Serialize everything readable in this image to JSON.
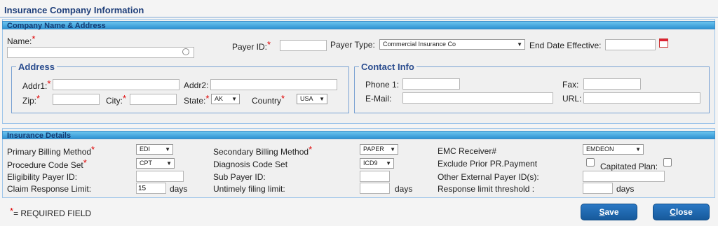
{
  "page": {
    "title": "Insurance Company Information"
  },
  "company": {
    "section_title": "Company Name & Address",
    "name_label": "Name:",
    "payer_id_label": "Payer ID:",
    "payer_type_label": "Payer Type:",
    "payer_type_value": "Commercial Insurance Co",
    "end_date_label": "End Date Effective:"
  },
  "address": {
    "legend": "Address",
    "addr1_label": "Addr1:",
    "addr2_label": "Addr2:",
    "zip_label": "Zip:",
    "city_label": "City:",
    "state_label": "State:",
    "state_value": "AK",
    "country_label": "Country",
    "country_value": "USA"
  },
  "contact": {
    "legend": "Contact Info",
    "phone_label": "Phone 1:",
    "fax_label": "Fax:",
    "email_label": "E-Mail:",
    "url_label": "URL:"
  },
  "details": {
    "section_title": "Insurance Details",
    "primary_billing_label": "Primary Billing Method",
    "primary_billing_value": "EDI",
    "secondary_billing_label": "Secondary Billing Method",
    "secondary_billing_value": "PAPER",
    "emc_label": "EMC Receiver#",
    "emc_value": "EMDEON",
    "procedure_label": "Procedure Code Set",
    "procedure_value": "CPT",
    "diagnosis_label": "Diagnosis Code Set",
    "diagnosis_value": "ICD9",
    "exclude_label": "Exclude Prior PR.Payment",
    "capitated_label": "Capitated Plan:",
    "eligibility_label": "Eligibility Payer ID:",
    "sub_payer_label": "Sub Payer ID:",
    "other_external_label": "Other External Payer ID(s):",
    "claim_response_label": "Claim Response Limit:",
    "claim_response_value": "15",
    "days1": "days",
    "untimely_label": "Untimely filing limit:",
    "days2": "days",
    "response_threshold_label": "Response limit threshold :",
    "days3": "days"
  },
  "footer": {
    "required_note": "= REQUIRED FIELD",
    "required_mark": "*",
    "save_first": "S",
    "save_rest": "ave",
    "close_first": "C",
    "close_rest": "lose"
  }
}
